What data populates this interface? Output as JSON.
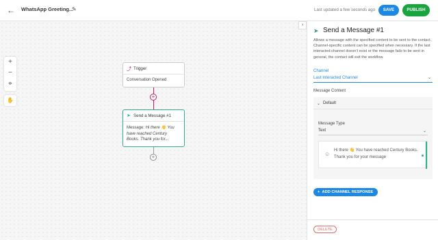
{
  "header": {
    "workflow_title": "WhatsApp Greeting...",
    "last_updated": "Last updated a few seconds ago",
    "save_label": "SAVE",
    "publish_label": "PUBLISH"
  },
  "canvas": {
    "trigger_node": {
      "label": "Trigger",
      "body": "Conversation Opened"
    },
    "message_node": {
      "label": "Send a Message #1",
      "prefix": "Message: ",
      "body": "Hi there 👋 You have reached Century Books. Thank you for..."
    },
    "controls": {
      "zoom_in": "+",
      "zoom_out": "−",
      "add": "+"
    }
  },
  "panel": {
    "title": "Send a Message #1",
    "description": "Allows a message with the specified content to be sent to the contact. Channel-specific content can be specified when necessary. If the last interacted channel doesn't exist or the message fails to be sent in general, the contact will exit the workflow.",
    "channel_label": "Channel",
    "channel_value": "Last Interacted Channel",
    "message_content_label": "Message Content",
    "default_section": "Default",
    "message_type_label": "Message Type",
    "message_type_value": "Text",
    "message_text": "Hi there 👋 You have reached Century Books. Thank you for your message",
    "add_channel_label": "ADD CHANNEL RESPONSE",
    "delete_label": "DELETE"
  },
  "colors": {
    "primary": "#1e88e5",
    "publish": "#1aa33f",
    "node_accent": "#2bb08a",
    "connector": "#c9184a",
    "delete": "#e36a6a"
  }
}
